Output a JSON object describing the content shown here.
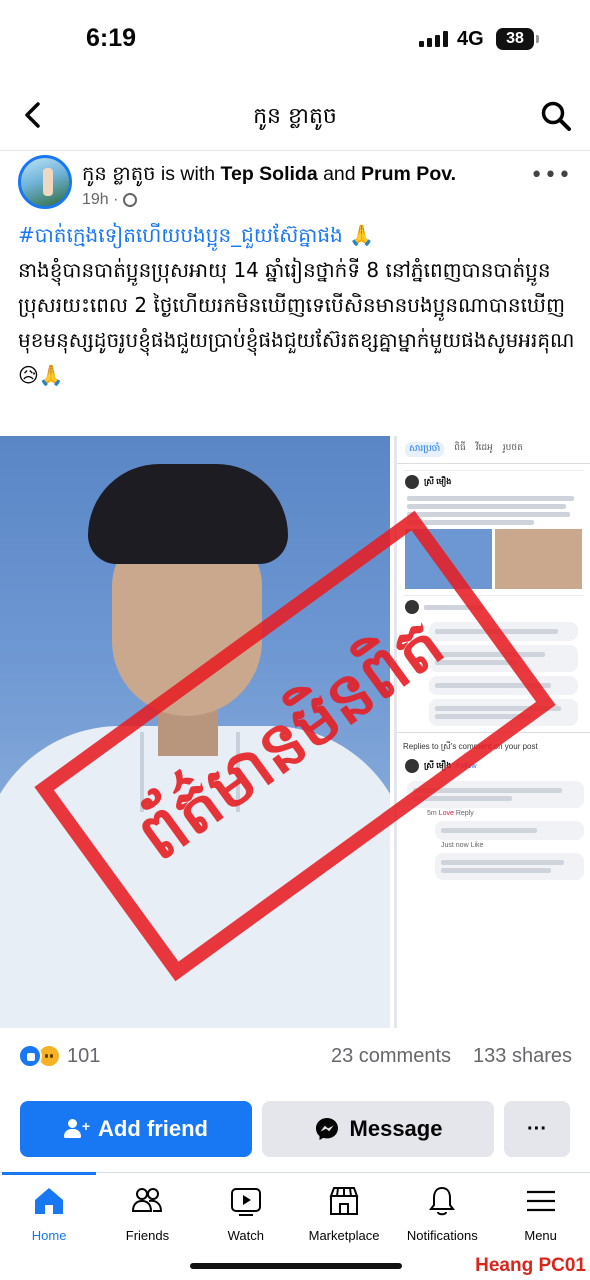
{
  "status_bar": {
    "time": "6:19",
    "network": "4G",
    "battery": "38"
  },
  "top_nav": {
    "title": "កូន ខ្លាតូច"
  },
  "post": {
    "author": "កូន ខ្លាតូច",
    "with_text": " is with ",
    "tagged_1": "Tep Solida",
    "and_text": " and ",
    "tagged_2": "Prum Pov.",
    "time": "19h ·",
    "hashtag": "#បាត់ក្មេងទៀតហើយបងប្អូន_ជួយស៊ែគ្នាផង 🙏",
    "body": "នាងខ្ញុំបានបាត់ប្អូនប្រុសអាយុ 14 ឆ្នាំរៀនថ្នាក់ទី 8 នៅភ្នំពេញបានបាត់ប្អូនប្រុសរយះពេល 2 ថ្ងៃហើយរកមិនឃើញទេបើសិនមានបងប្អូនណាបានឃើញមុខមនុស្សដូចរូបខ្ញុំផងជួយប្រាប់ខ្ញុំផងជួយស៊ែរតខ្សគ្នាម្នាក់មួយផងសូមអរគុណ😥🙏",
    "stamp_text": "ព័ត៌មានមិនពិត"
  },
  "screenshot": {
    "tabs": [
      "សារប្រចាំ",
      "ពិធី",
      "វីដេអូ",
      "រូបថត"
    ],
    "poster": "ស្រី មឿង",
    "replies_header": "Replies to ស្រី's comment on your post",
    "follow": "Follow",
    "reply_time": "5m",
    "love": "Love",
    "reply": "Reply",
    "just_now": "Just now",
    "like": "Like"
  },
  "stats": {
    "reactions": "101",
    "comments": "23 comments",
    "shares": "133 shares"
  },
  "actions": {
    "add_friend": "Add friend",
    "message": "Message",
    "more": "···"
  },
  "tabbar": {
    "home": "Home",
    "friends": "Friends",
    "watch": "Watch",
    "marketplace": "Marketplace",
    "notifications": "Notifications",
    "menu": "Menu"
  },
  "watermark": "Heang PC01",
  "colors": {
    "accent": "#1877f2",
    "stamp": "#e61e23",
    "watermark": "#d9261c"
  }
}
